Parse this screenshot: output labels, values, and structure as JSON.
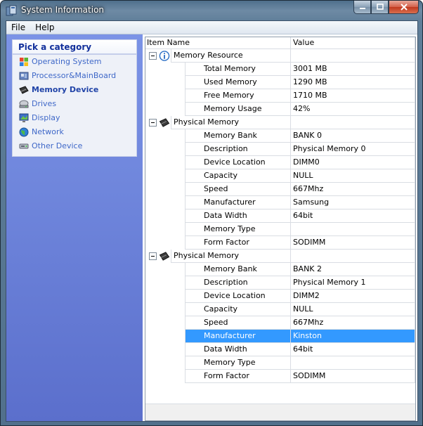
{
  "window": {
    "title": "System Information"
  },
  "menu": [
    {
      "label": "File"
    },
    {
      "label": "Help"
    }
  ],
  "sidebar": {
    "header": "Pick a category",
    "items": [
      {
        "label": "Operating System",
        "icon": "windows-logo-icon",
        "active": false
      },
      {
        "label": "Processor&MainBoard",
        "icon": "motherboard-icon",
        "active": false
      },
      {
        "label": "Memory Device",
        "icon": "memory-chip-icon",
        "active": true
      },
      {
        "label": "Drives",
        "icon": "drive-icon",
        "active": false
      },
      {
        "label": "Display",
        "icon": "display-icon",
        "active": false
      },
      {
        "label": "Network",
        "icon": "globe-icon",
        "active": false
      },
      {
        "label": "Other Device",
        "icon": "device-icon",
        "active": false
      }
    ]
  },
  "grid": {
    "columns": {
      "name": "Item Name",
      "value": "Value"
    },
    "selection_color": "#3399ff",
    "groups": [
      {
        "name": "Memory Resource",
        "icon": "info-icon",
        "rows": [
          {
            "name": "Total Memory",
            "value": "3001 MB"
          },
          {
            "name": "Used Memory",
            "value": "1290 MB"
          },
          {
            "name": "Free Memory",
            "value": "1710 MB"
          },
          {
            "name": "Memory Usage",
            "value": "42%"
          }
        ]
      },
      {
        "name": "Physical Memory",
        "icon": "memory-chip-icon",
        "rows": [
          {
            "name": "Memory Bank",
            "value": "BANK 0"
          },
          {
            "name": "Description",
            "value": "Physical Memory 0"
          },
          {
            "name": "Device Location",
            "value": "DIMM0"
          },
          {
            "name": "Capacity",
            "value": "NULL"
          },
          {
            "name": "Speed",
            "value": "667Mhz"
          },
          {
            "name": "Manufacturer",
            "value": "Samsung"
          },
          {
            "name": "Data Width",
            "value": "64bit"
          },
          {
            "name": "Memory Type",
            "value": ""
          },
          {
            "name": "Form Factor",
            "value": "SODIMM"
          }
        ]
      },
      {
        "name": "Physical Memory",
        "icon": "memory-chip-icon",
        "rows": [
          {
            "name": "Memory Bank",
            "value": "BANK 2"
          },
          {
            "name": "Description",
            "value": "Physical Memory 1"
          },
          {
            "name": "Device Location",
            "value": "DIMM2"
          },
          {
            "name": "Capacity",
            "value": "NULL"
          },
          {
            "name": "Speed",
            "value": "667Mhz"
          },
          {
            "name": "Manufacturer",
            "value": "Kinston",
            "selected": true
          },
          {
            "name": "Data Width",
            "value": "64bit"
          },
          {
            "name": "Memory Type",
            "value": ""
          },
          {
            "name": "Form Factor",
            "value": "SODIMM"
          }
        ]
      }
    ]
  }
}
